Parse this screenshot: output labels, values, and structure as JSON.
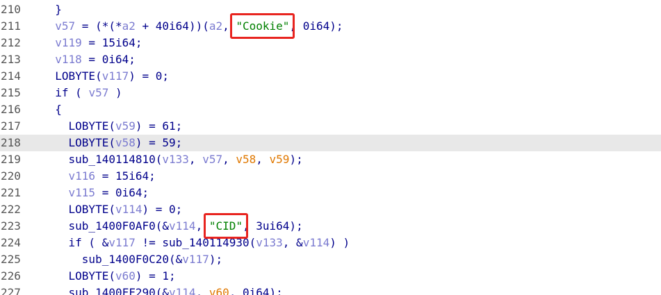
{
  "current_line": "218",
  "colors": {
    "plain": "#00008b",
    "variable": "#7b7bd0",
    "variable_alt": "#e07800",
    "string": "#008000",
    "line_number": "#555555",
    "highlight_line_bg": "#e8e8e8",
    "annotation_box": "#e8241f"
  },
  "annotations": [
    {
      "label": "cookie-string-highlight",
      "target_line": "211"
    },
    {
      "label": "cid-string-highlight",
      "target_line": "223"
    }
  ],
  "lines": [
    {
      "num": "210",
      "indent": "  ",
      "tokens": [
        {
          "t": "}",
          "k": "t"
        }
      ]
    },
    {
      "num": "211",
      "indent": "  ",
      "tokens": [
        {
          "t": "v57",
          "k": "v"
        },
        {
          "t": " = (*(*",
          "k": "t"
        },
        {
          "t": "a2",
          "k": "v"
        },
        {
          "t": " + 40i64))(",
          "k": "t"
        },
        {
          "t": "a2",
          "k": "v"
        },
        {
          "t": ", ",
          "k": "t"
        },
        {
          "t": "\"Cookie\"",
          "k": "s"
        },
        {
          "t": ", 0i64);",
          "k": "t"
        }
      ]
    },
    {
      "num": "212",
      "indent": "  ",
      "tokens": [
        {
          "t": "v119",
          "k": "v"
        },
        {
          "t": " = 15i64;",
          "k": "t"
        }
      ]
    },
    {
      "num": "213",
      "indent": "  ",
      "tokens": [
        {
          "t": "v118",
          "k": "v"
        },
        {
          "t": " = 0i64;",
          "k": "t"
        }
      ]
    },
    {
      "num": "214",
      "indent": "  ",
      "tokens": [
        {
          "t": "LOBYTE(",
          "k": "t"
        },
        {
          "t": "v117",
          "k": "v"
        },
        {
          "t": ") = 0;",
          "k": "t"
        }
      ]
    },
    {
      "num": "215",
      "indent": "  ",
      "tokens": [
        {
          "t": "if ( ",
          "k": "t"
        },
        {
          "t": "v57",
          "k": "v"
        },
        {
          "t": " )",
          "k": "t"
        }
      ]
    },
    {
      "num": "216",
      "indent": "  ",
      "tokens": [
        {
          "t": "{",
          "k": "t"
        }
      ]
    },
    {
      "num": "217",
      "indent": "    ",
      "tokens": [
        {
          "t": "LOBYTE(",
          "k": "t"
        },
        {
          "t": "v59",
          "k": "v"
        },
        {
          "t": ") = 61;",
          "k": "t"
        }
      ]
    },
    {
      "num": "218",
      "indent": "    ",
      "tokens": [
        {
          "t": "LOBYTE(",
          "k": "t"
        },
        {
          "t": "v58",
          "k": "v"
        },
        {
          "t": ") = 59;",
          "k": "t"
        }
      ]
    },
    {
      "num": "219",
      "indent": "    ",
      "tokens": [
        {
          "t": "sub_140114810(",
          "k": "t"
        },
        {
          "t": "v133",
          "k": "v"
        },
        {
          "t": ", ",
          "k": "t"
        },
        {
          "t": "v57",
          "k": "v"
        },
        {
          "t": ", ",
          "k": "t"
        },
        {
          "t": "v58",
          "k": "o"
        },
        {
          "t": ", ",
          "k": "t"
        },
        {
          "t": "v59",
          "k": "o"
        },
        {
          "t": ");",
          "k": "t"
        }
      ]
    },
    {
      "num": "220",
      "indent": "    ",
      "tokens": [
        {
          "t": "v116",
          "k": "v"
        },
        {
          "t": " = 15i64;",
          "k": "t"
        }
      ]
    },
    {
      "num": "221",
      "indent": "    ",
      "tokens": [
        {
          "t": "v115",
          "k": "v"
        },
        {
          "t": " = 0i64;",
          "k": "t"
        }
      ]
    },
    {
      "num": "222",
      "indent": "    ",
      "tokens": [
        {
          "t": "LOBYTE(",
          "k": "t"
        },
        {
          "t": "v114",
          "k": "v"
        },
        {
          "t": ") = 0;",
          "k": "t"
        }
      ]
    },
    {
      "num": "223",
      "indent": "    ",
      "tokens": [
        {
          "t": "sub_1400F0AF0(&",
          "k": "t"
        },
        {
          "t": "v114",
          "k": "v"
        },
        {
          "t": ", ",
          "k": "t"
        },
        {
          "t": "\"CID\"",
          "k": "s"
        },
        {
          "t": ", 3ui64);",
          "k": "t"
        }
      ]
    },
    {
      "num": "224",
      "indent": "    ",
      "tokens": [
        {
          "t": "if ( &",
          "k": "t"
        },
        {
          "t": "v117",
          "k": "v"
        },
        {
          "t": " != sub_140114930(",
          "k": "t"
        },
        {
          "t": "v133",
          "k": "v"
        },
        {
          "t": ", &",
          "k": "t"
        },
        {
          "t": "v114",
          "k": "v"
        },
        {
          "t": ") )",
          "k": "t"
        }
      ]
    },
    {
      "num": "225",
      "indent": "      ",
      "tokens": [
        {
          "t": "sub_1400F0C20(&",
          "k": "t"
        },
        {
          "t": "v117",
          "k": "v"
        },
        {
          "t": ");",
          "k": "t"
        }
      ]
    },
    {
      "num": "226",
      "indent": "    ",
      "tokens": [
        {
          "t": "LOBYTE(",
          "k": "t"
        },
        {
          "t": "v60",
          "k": "v"
        },
        {
          "t": ") = 1;",
          "k": "t"
        }
      ]
    },
    {
      "num": "227",
      "indent": "    ",
      "tokens": [
        {
          "t": "sub_1400FF290(&",
          "k": "t"
        },
        {
          "t": "v114",
          "k": "v"
        },
        {
          "t": ", ",
          "k": "t"
        },
        {
          "t": "v60",
          "k": "o"
        },
        {
          "t": ", 0i64);",
          "k": "t"
        }
      ]
    }
  ]
}
